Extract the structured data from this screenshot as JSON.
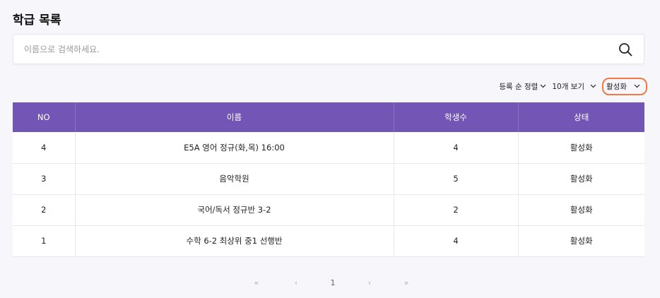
{
  "page": {
    "title": "학급 목록"
  },
  "search": {
    "placeholder": "이름으로 검색하세요.",
    "value": ""
  },
  "controls": {
    "sort_label": "등록 순 정렬",
    "page_size_label": "10개 보기",
    "status_filter_label": "활성화"
  },
  "table": {
    "headers": {
      "no": "NO",
      "name": "이름",
      "count": "학생수",
      "status": "상태"
    },
    "rows": [
      {
        "no": "4",
        "name": "E5A 영어 정규(화,목) 16:00",
        "count": "4",
        "status": "활성화"
      },
      {
        "no": "3",
        "name": "음악학원",
        "count": "5",
        "status": "활성화"
      },
      {
        "no": "2",
        "name": "국어/독서 정규반 3-2",
        "count": "2",
        "status": "활성화"
      },
      {
        "no": "1",
        "name": "수학 6-2 최상위 중1 선행반",
        "count": "4",
        "status": "활성화"
      }
    ]
  },
  "pagination": {
    "first": "«",
    "prev": "‹",
    "current": "1",
    "next": "›",
    "last": "»"
  },
  "colors": {
    "header_bg": "#7255b5",
    "highlight_border": "#f07a45",
    "page_bg": "#f7f6fa"
  },
  "icons": {
    "search": "search-icon",
    "dropdown": "chevron-down-icon"
  }
}
